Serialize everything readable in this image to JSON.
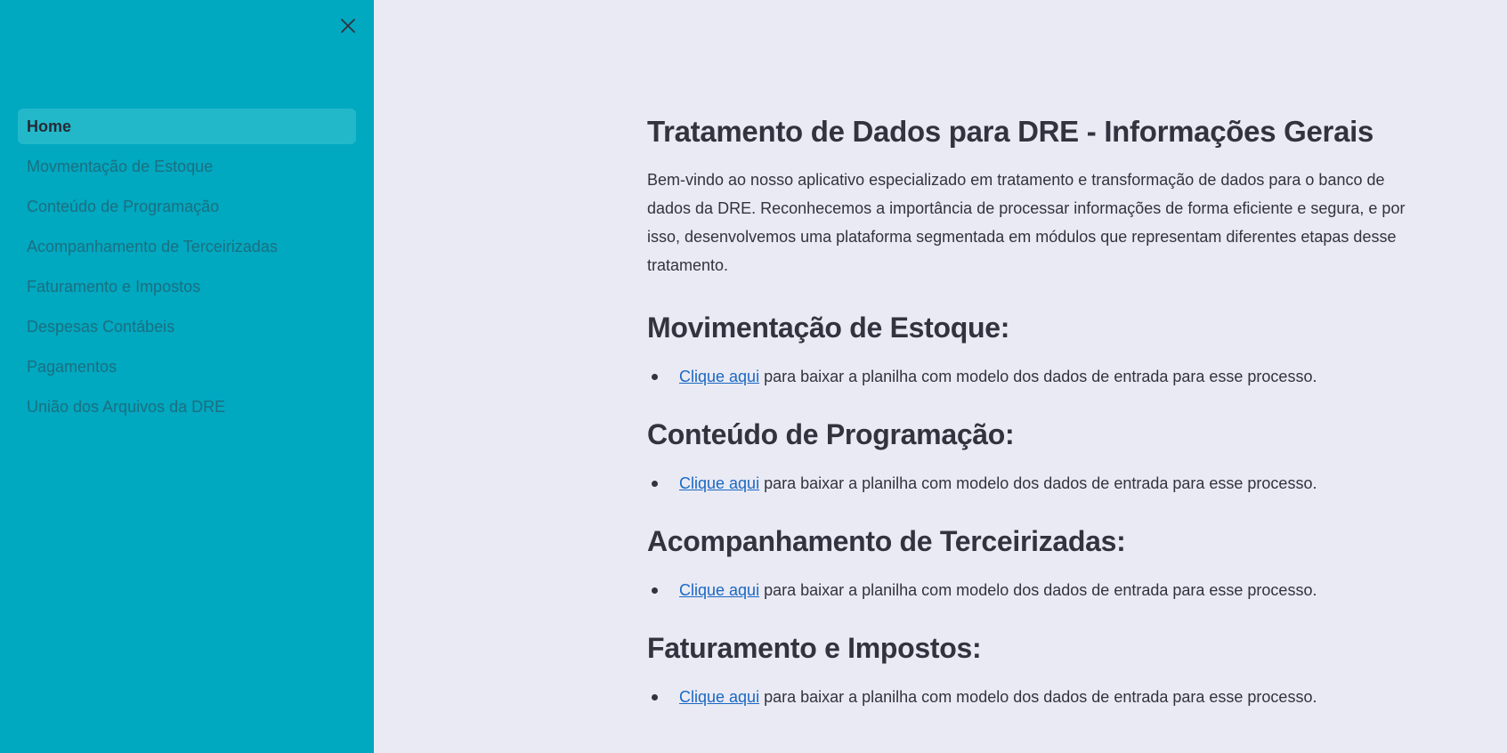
{
  "sidebar": {
    "items": [
      {
        "label": "Home",
        "active": true
      },
      {
        "label": "Movmentação de Estoque",
        "active": false
      },
      {
        "label": "Conteúdo de Programação",
        "active": false
      },
      {
        "label": "Acompanhamento de Terceirizadas",
        "active": false
      },
      {
        "label": "Faturamento e Impostos",
        "active": false
      },
      {
        "label": "Despesas Contábeis",
        "active": false
      },
      {
        "label": "Pagamentos",
        "active": false
      },
      {
        "label": "União dos Arquivos da DRE",
        "active": false
      }
    ],
    "close_icon": "close-icon"
  },
  "main": {
    "title": "Tratamento de Dados para DRE - Informações Gerais",
    "intro": "Bem-vindo ao nosso aplicativo especializado em tratamento e transformação de dados para o banco de dados da DRE. Reconhecemos a importância de processar informações de forma eficiente e segura, e por isso, desenvolvemos uma plataforma segmentada em módulos que representam diferentes etapas desse tratamento.",
    "sections": [
      {
        "heading": "Movimentação de Estoque:",
        "link_text": "Clique aqui",
        "rest_text": " para baixar a planilha com modelo dos dados de entrada para esse processo."
      },
      {
        "heading": "Conteúdo de Programação:",
        "link_text": "Clique aqui",
        "rest_text": " para baixar a planilha com modelo dos dados de entrada para esse processo."
      },
      {
        "heading": "Acompanhamento de Terceirizadas:",
        "link_text": "Clique aqui",
        "rest_text": " para baixar a planilha com modelo dos dados de entrada para esse processo."
      },
      {
        "heading": "Faturamento e Impostos:",
        "link_text": "Clique aqui",
        "rest_text": " para baixar a planilha com modelo dos dados de entrada para esse processo."
      }
    ]
  },
  "colors": {
    "sidebar_bg": "#00a8c0",
    "main_bg": "#eaeaf4",
    "link": "#1a68c4",
    "text": "#31333f"
  }
}
